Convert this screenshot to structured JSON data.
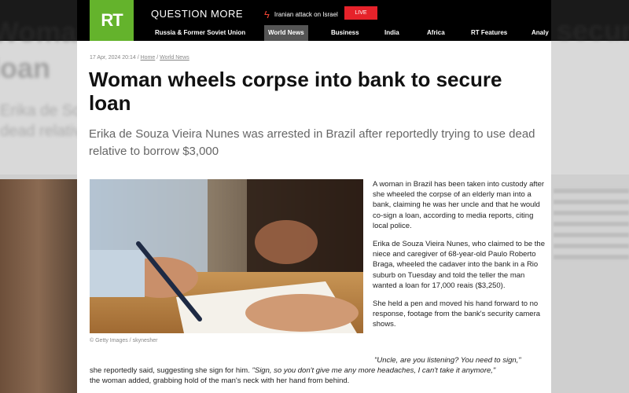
{
  "header": {
    "logo_text": "RT",
    "site_tagline": "QUESTION MORE",
    "breaking_text": "Iranian attack on Israel",
    "live_label": "LIVE",
    "nav": [
      "Russia & Former Soviet Union",
      "World News",
      "Business",
      "India",
      "Africa",
      "RT Features",
      "Analy"
    ],
    "active_nav": "World News"
  },
  "article": {
    "date": "17 Apr, 2024 20:14",
    "breadcrumb": [
      "Home",
      "World News"
    ],
    "title": "Woman wheels corpse into bank to secure loan",
    "subtitle": "Erika de Souza Vieira Nunes was arrested in Brazil after reportedly trying to use dead relative to borrow $3,000",
    "image_credit": "© Getty Images / skynesher",
    "paragraphs": [
      "A woman in Brazil has been taken into custody after she wheeled the corpse of an elderly man into a bank, claiming he was her uncle and that he would co-sign a loan, according to media reports, citing local police.",
      "Erika de Souza Vieira Nunes, who claimed to be the niece and caregiver of 68-year-old Paulo Roberto Braga, wheeled the cadaver into the bank in a Rio suburb on Tuesday and told the teller the man wanted a loan for 17,000 reais ($3,250).",
      "She held a pen and moved his hand forward to no response, footage from the bank's security camera shows."
    ],
    "quote_1": "\"Uncle, are you listening? You need to sign,\"",
    "quote_text_1": "she reportedly said, suggesting she sign for him.",
    "quote_2": "\"Sign, so you don't give me any more headaches, I can't take it anymore,\"",
    "quote_text_2": "the woman added, grabbing hold of the man's neck with her hand from behind."
  },
  "colors": {
    "brand_green": "#64b32c",
    "live_red": "#e6222a",
    "header_bg": "#000000"
  }
}
